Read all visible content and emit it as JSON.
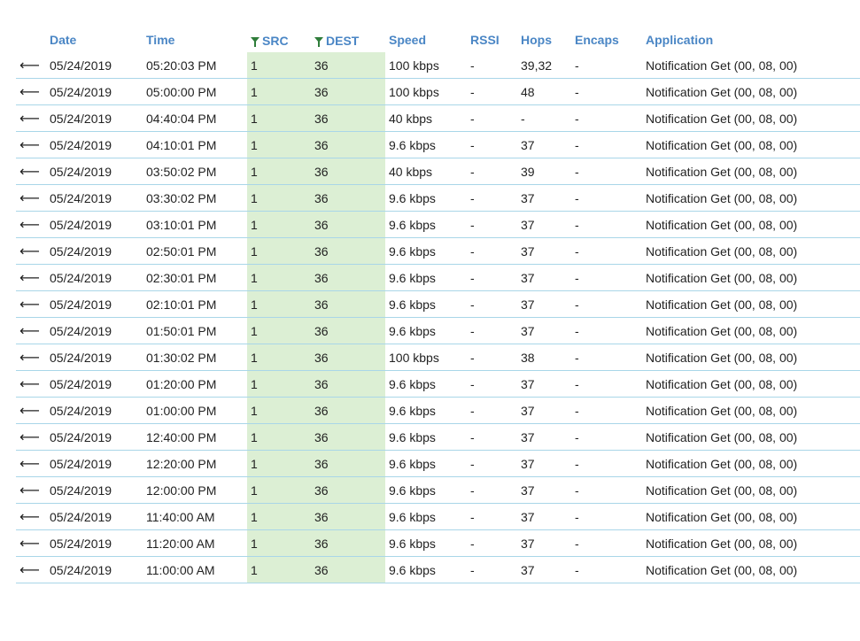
{
  "table": {
    "columns": [
      {
        "key": "dir",
        "label": ""
      },
      {
        "key": "date",
        "label": "Date"
      },
      {
        "key": "time",
        "label": "Time"
      },
      {
        "key": "src",
        "label": "SRC",
        "filtered": true
      },
      {
        "key": "dest",
        "label": "DEST",
        "filtered": true
      },
      {
        "key": "speed",
        "label": "Speed"
      },
      {
        "key": "rssi",
        "label": "RSSI"
      },
      {
        "key": "hops",
        "label": "Hops"
      },
      {
        "key": "encaps",
        "label": "Encaps"
      },
      {
        "key": "application",
        "label": "Application"
      }
    ],
    "rows": [
      {
        "dir": "⟵",
        "date": "05/24/2019",
        "time": "05:20:03 PM",
        "src": "1",
        "dest": "36",
        "speed": "100 kbps",
        "rssi": "-",
        "hops": "39,32",
        "encaps": "-",
        "application": "Notification Get (00, 08, 00)"
      },
      {
        "dir": "⟵",
        "date": "05/24/2019",
        "time": "05:00:00 PM",
        "src": "1",
        "dest": "36",
        "speed": "100 kbps",
        "rssi": "-",
        "hops": "48",
        "encaps": "-",
        "application": "Notification Get (00, 08, 00)"
      },
      {
        "dir": "⟵",
        "date": "05/24/2019",
        "time": "04:40:04 PM",
        "src": "1",
        "dest": "36",
        "speed": "40 kbps",
        "rssi": "-",
        "hops": "-",
        "encaps": "-",
        "application": "Notification Get (00, 08, 00)"
      },
      {
        "dir": "⟵",
        "date": "05/24/2019",
        "time": "04:10:01 PM",
        "src": "1",
        "dest": "36",
        "speed": "9.6 kbps",
        "rssi": "-",
        "hops": "37",
        "encaps": "-",
        "application": "Notification Get (00, 08, 00)"
      },
      {
        "dir": "⟵",
        "date": "05/24/2019",
        "time": "03:50:02 PM",
        "src": "1",
        "dest": "36",
        "speed": "40 kbps",
        "rssi": "-",
        "hops": "39",
        "encaps": "-",
        "application": "Notification Get (00, 08, 00)"
      },
      {
        "dir": "⟵",
        "date": "05/24/2019",
        "time": "03:30:02 PM",
        "src": "1",
        "dest": "36",
        "speed": "9.6 kbps",
        "rssi": "-",
        "hops": "37",
        "encaps": "-",
        "application": "Notification Get (00, 08, 00)"
      },
      {
        "dir": "⟵",
        "date": "05/24/2019",
        "time": "03:10:01 PM",
        "src": "1",
        "dest": "36",
        "speed": "9.6 kbps",
        "rssi": "-",
        "hops": "37",
        "encaps": "-",
        "application": "Notification Get (00, 08, 00)"
      },
      {
        "dir": "⟵",
        "date": "05/24/2019",
        "time": "02:50:01 PM",
        "src": "1",
        "dest": "36",
        "speed": "9.6 kbps",
        "rssi": "-",
        "hops": "37",
        "encaps": "-",
        "application": "Notification Get (00, 08, 00)"
      },
      {
        "dir": "⟵",
        "date": "05/24/2019",
        "time": "02:30:01 PM",
        "src": "1",
        "dest": "36",
        "speed": "9.6 kbps",
        "rssi": "-",
        "hops": "37",
        "encaps": "-",
        "application": "Notification Get (00, 08, 00)"
      },
      {
        "dir": "⟵",
        "date": "05/24/2019",
        "time": "02:10:01 PM",
        "src": "1",
        "dest": "36",
        "speed": "9.6 kbps",
        "rssi": "-",
        "hops": "37",
        "encaps": "-",
        "application": "Notification Get (00, 08, 00)"
      },
      {
        "dir": "⟵",
        "date": "05/24/2019",
        "time": "01:50:01 PM",
        "src": "1",
        "dest": "36",
        "speed": "9.6 kbps",
        "rssi": "-",
        "hops": "37",
        "encaps": "-",
        "application": "Notification Get (00, 08, 00)"
      },
      {
        "dir": "⟵",
        "date": "05/24/2019",
        "time": "01:30:02 PM",
        "src": "1",
        "dest": "36",
        "speed": "100 kbps",
        "rssi": "-",
        "hops": "38",
        "encaps": "-",
        "application": "Notification Get (00, 08, 00)"
      },
      {
        "dir": "⟵",
        "date": "05/24/2019",
        "time": "01:20:00 PM",
        "src": "1",
        "dest": "36",
        "speed": "9.6 kbps",
        "rssi": "-",
        "hops": "37",
        "encaps": "-",
        "application": "Notification Get (00, 08, 00)"
      },
      {
        "dir": "⟵",
        "date": "05/24/2019",
        "time": "01:00:00 PM",
        "src": "1",
        "dest": "36",
        "speed": "9.6 kbps",
        "rssi": "-",
        "hops": "37",
        "encaps": "-",
        "application": "Notification Get (00, 08, 00)"
      },
      {
        "dir": "⟵",
        "date": "05/24/2019",
        "time": "12:40:00 PM",
        "src": "1",
        "dest": "36",
        "speed": "9.6 kbps",
        "rssi": "-",
        "hops": "37",
        "encaps": "-",
        "application": "Notification Get (00, 08, 00)"
      },
      {
        "dir": "⟵",
        "date": "05/24/2019",
        "time": "12:20:00 PM",
        "src": "1",
        "dest": "36",
        "speed": "9.6 kbps",
        "rssi": "-",
        "hops": "37",
        "encaps": "-",
        "application": "Notification Get (00, 08, 00)"
      },
      {
        "dir": "⟵",
        "date": "05/24/2019",
        "time": "12:00:00 PM",
        "src": "1",
        "dest": "36",
        "speed": "9.6 kbps",
        "rssi": "-",
        "hops": "37",
        "encaps": "-",
        "application": "Notification Get (00, 08, 00)"
      },
      {
        "dir": "⟵",
        "date": "05/24/2019",
        "time": "11:40:00 AM",
        "src": "1",
        "dest": "36",
        "speed": "9.6 kbps",
        "rssi": "-",
        "hops": "37",
        "encaps": "-",
        "application": "Notification Get (00, 08, 00)"
      },
      {
        "dir": "⟵",
        "date": "05/24/2019",
        "time": "11:20:00 AM",
        "src": "1",
        "dest": "36",
        "speed": "9.6 kbps",
        "rssi": "-",
        "hops": "37",
        "encaps": "-",
        "application": "Notification Get (00, 08, 00)"
      },
      {
        "dir": "⟵",
        "date": "05/24/2019",
        "time": "11:00:00 AM",
        "src": "1",
        "dest": "36",
        "speed": "9.6 kbps",
        "rssi": "-",
        "hops": "37",
        "encaps": "-",
        "application": "Notification Get (00, 08, 00)"
      }
    ]
  },
  "colors": {
    "header_text": "#4a86c5",
    "filter_fill": "#dcefd4",
    "filter_icon": "#2f7d3a",
    "row_border": "#a9d6e8"
  },
  "icons": {
    "filter": "filter-funnel-icon",
    "direction": "arrow-left-icon"
  }
}
